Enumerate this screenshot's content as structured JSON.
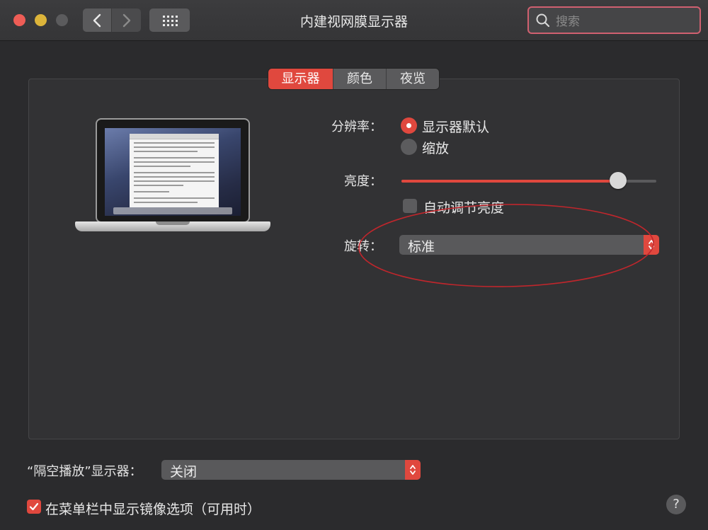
{
  "window": {
    "title": "内建视网膜显示器",
    "search_placeholder": "搜索"
  },
  "tabs": [
    {
      "label": "显示器",
      "active": true
    },
    {
      "label": "颜色",
      "active": false
    },
    {
      "label": "夜览",
      "active": false
    }
  ],
  "resolution": {
    "label": "分辨率：",
    "options": [
      {
        "label": "显示器默认",
        "selected": true
      },
      {
        "label": "缩放",
        "selected": false
      }
    ]
  },
  "brightness": {
    "label": "亮度：",
    "level": 0.85,
    "auto_label": "自动调节亮度",
    "auto_checked": false
  },
  "rotation": {
    "label": "旋转：",
    "value": "标准"
  },
  "airplay": {
    "label": "“隔空播放”显示器：",
    "value": "关闭"
  },
  "menubar_mirroring": {
    "label": "在菜单栏中显示镜像选项（可用时）",
    "checked": true
  },
  "help": {
    "label": "?"
  },
  "colors": {
    "accent": "#e0483e",
    "annotation": "#c0262c"
  }
}
